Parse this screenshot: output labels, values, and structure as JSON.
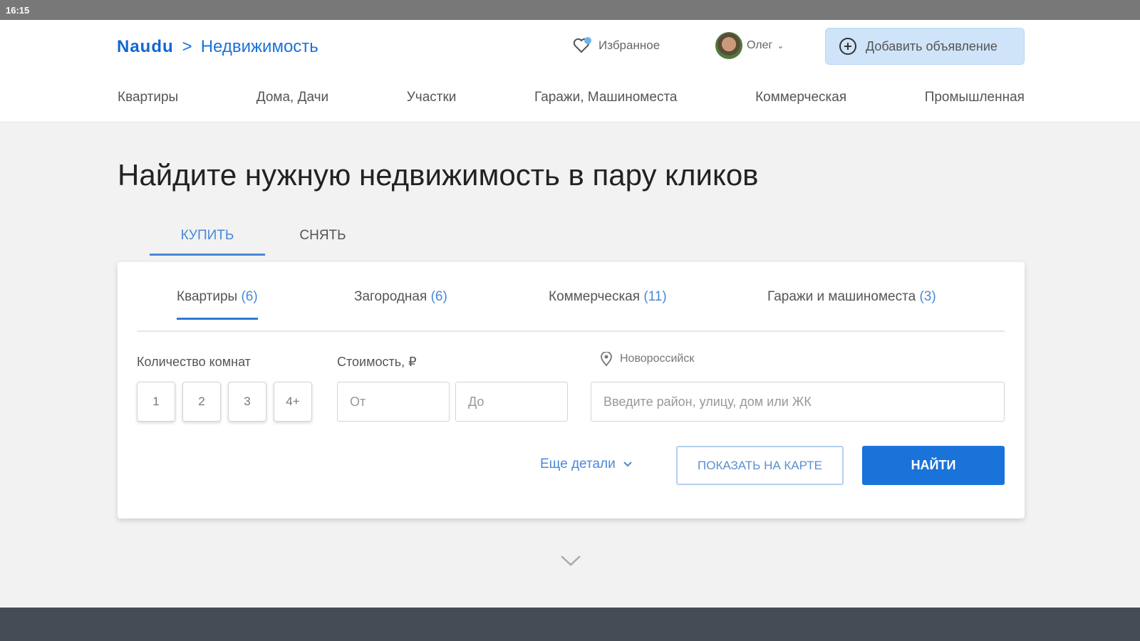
{
  "status_bar": {
    "time": "16:15"
  },
  "header": {
    "brand": "Naudu",
    "separator": ">",
    "section": "Недвижимость",
    "favorites": "Избранное",
    "user_name": "Олег",
    "add_listing": "Добавить объявление"
  },
  "nav": [
    "Квартиры",
    "Дома, Дачи",
    "Участки",
    "Гаражи, Машиноместа",
    "Коммерческая",
    "Промышленная"
  ],
  "hero": {
    "title": "Найдите нужную недвижимость в пару кликов"
  },
  "modes": [
    {
      "label": "КУПИТЬ",
      "active": true
    },
    {
      "label": "СНЯТЬ",
      "active": false
    }
  ],
  "property_tabs": [
    {
      "label": "Квартиры",
      "count": "(6)"
    },
    {
      "label": "Загородная",
      "count": "(6)"
    },
    {
      "label": "Коммерческая",
      "count": "(11)"
    },
    {
      "label": "Гаражи и машиноместа",
      "count": "(3)"
    }
  ],
  "filters": {
    "rooms_label": "Количество комнат",
    "rooms": [
      "1",
      "2",
      "3",
      "4+"
    ],
    "price_label": "Стоимость, ₽",
    "price_from_placeholder": "От",
    "price_to_placeholder": "До",
    "city": "Новороссийск",
    "address_placeholder": "Введите район, улицу, дом или ЖК"
  },
  "actions": {
    "more_details": "Еще детали",
    "show_on_map": "ПОКАЗАТЬ НА КАРТЕ",
    "find": "НАЙТИ"
  },
  "colors": {
    "accent": "#1a73d9",
    "footer": "#464c55"
  }
}
